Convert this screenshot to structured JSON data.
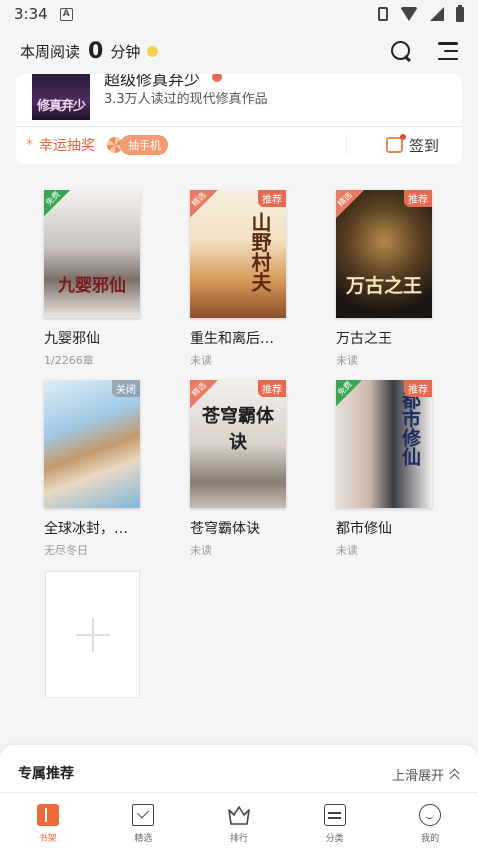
{
  "status_bar": {
    "time": "3:34",
    "notif_letter": "A"
  },
  "header": {
    "read_label": "本周阅读",
    "read_minutes": "0",
    "read_unit": "分钟"
  },
  "top_card": {
    "title": "超级修真弃少",
    "cover_text": "修真弃少",
    "subtitle": "3.3万人读过的现代修真作品",
    "lottery_label": "幸运抽奖",
    "lottery_pill": "抽手机",
    "signin_label": "签到"
  },
  "books": [
    {
      "title": "九婴邪仙",
      "status": "1/2266章",
      "tag": "免费",
      "cover_text": "九婴邪仙"
    },
    {
      "title": "重生和离后…",
      "status": "未读",
      "tag": "精选",
      "tag2": "推荐",
      "cover_text": "山野村夫"
    },
    {
      "title": "万古之王",
      "status": "未读",
      "tag": "精选",
      "tag2": "推荐",
      "cover_text": "万古之王"
    },
    {
      "title": "全球冰封，…",
      "status": "无尽冬日",
      "tag2": "关闭",
      "cover_text": ""
    },
    {
      "title": "苍穹霸体诀",
      "status": "未读",
      "tag": "精选",
      "tag2": "推荐",
      "cover_text": "苍穹霸体诀"
    },
    {
      "title": "都市修仙",
      "status": "未读",
      "tag": "免费",
      "tag2": "推荐",
      "cover_text": "都市修仙"
    }
  ],
  "recommend": {
    "title": "专属推荐",
    "expand_label": "上滑展开"
  },
  "tabs": [
    {
      "label": "书架",
      "icon": "bookshelf-icon"
    },
    {
      "label": "精选",
      "icon": "featured-icon"
    },
    {
      "label": "排行",
      "icon": "ranking-icon"
    },
    {
      "label": "分类",
      "icon": "category-icon"
    },
    {
      "label": "我的",
      "icon": "profile-icon"
    }
  ],
  "colors": {
    "accent": "#ec6a3c",
    "free_tag": "#3aa655",
    "rec_tag": "#e96a52"
  }
}
